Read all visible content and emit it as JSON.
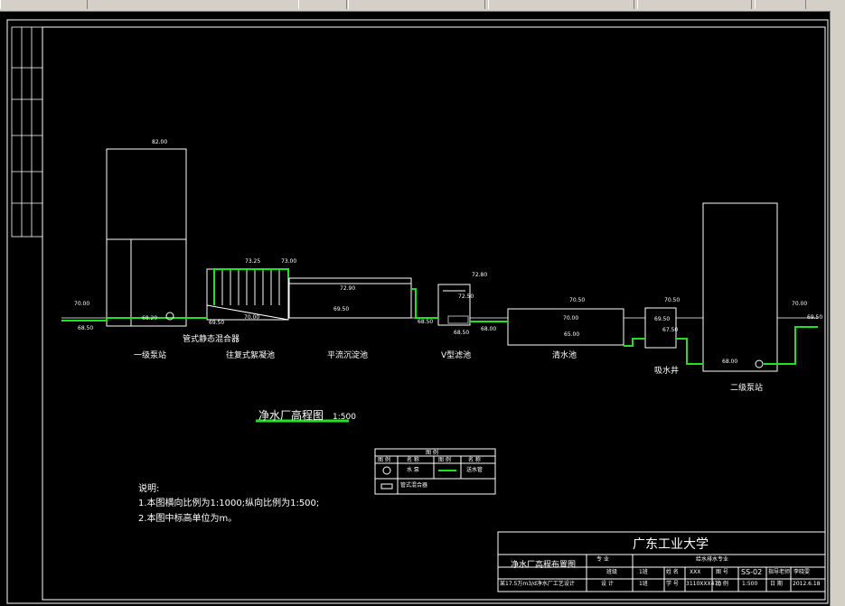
{
  "diagram": {
    "title": "净水厂高程图",
    "scale": "1:500",
    "units": {
      "pump1": "一级泵站",
      "mixer": "管式静态混合器",
      "floc": "往复式絮凝池",
      "sed": "平流沉淀池",
      "vfilter": "V型滤池",
      "clear": "清水池",
      "well": "吸水井",
      "pump2": "二级泵站"
    },
    "levels": {
      "l1": "70.00",
      "l2": "68.50",
      "l3": "82.00",
      "l4": "68.20",
      "l5": "69.50",
      "l6": "73.25",
      "l7": "73.00",
      "l8": "70.00",
      "l9": "72.90",
      "l10": "69.50",
      "l11": "72.80",
      "l12": "72.50",
      "l13": "68.50",
      "l14": "68.50",
      "l15": "68.00",
      "l16": "70.50",
      "l17": "70.00",
      "l18": "65.00",
      "l19": "70.50",
      "l20": "69.50",
      "l21": "67.50",
      "l22": "68.00",
      "l23": "70.00",
      "l24": "69.50"
    },
    "legend": {
      "title": "图 例",
      "headers": [
        "图 例",
        "名 称",
        "图 例",
        "名 称"
      ],
      "row1": [
        "水 泵",
        "送水管"
      ],
      "row2": [
        "管式混合器"
      ]
    },
    "notes": {
      "heading": "说明:",
      "line1": "1.本图横向比例为1:1000;纵向比例为1:500;",
      "line2": "2.本图中标高单位为m。"
    },
    "titleblock": {
      "school": "广东工业大学",
      "drawing_name": "净水厂高程布置图",
      "major_label": "专 业",
      "major": "给水排水专业",
      "c1": "班级",
      "c2": "1班",
      "c3": "姓 名",
      "c4": "XXX",
      "c5": "图 号",
      "c6": "SS-02",
      "c7": "指导老师",
      "c8": "李晓雯",
      "project": "某17.5万m3/d净水厂工艺设计",
      "d1": "设 计",
      "d2": "1班",
      "d3": "学 号",
      "d4": "3110XXX470",
      "d5": "比 例",
      "d6": "1:500",
      "d7": "日 期",
      "d8": "2012.6.18"
    }
  }
}
